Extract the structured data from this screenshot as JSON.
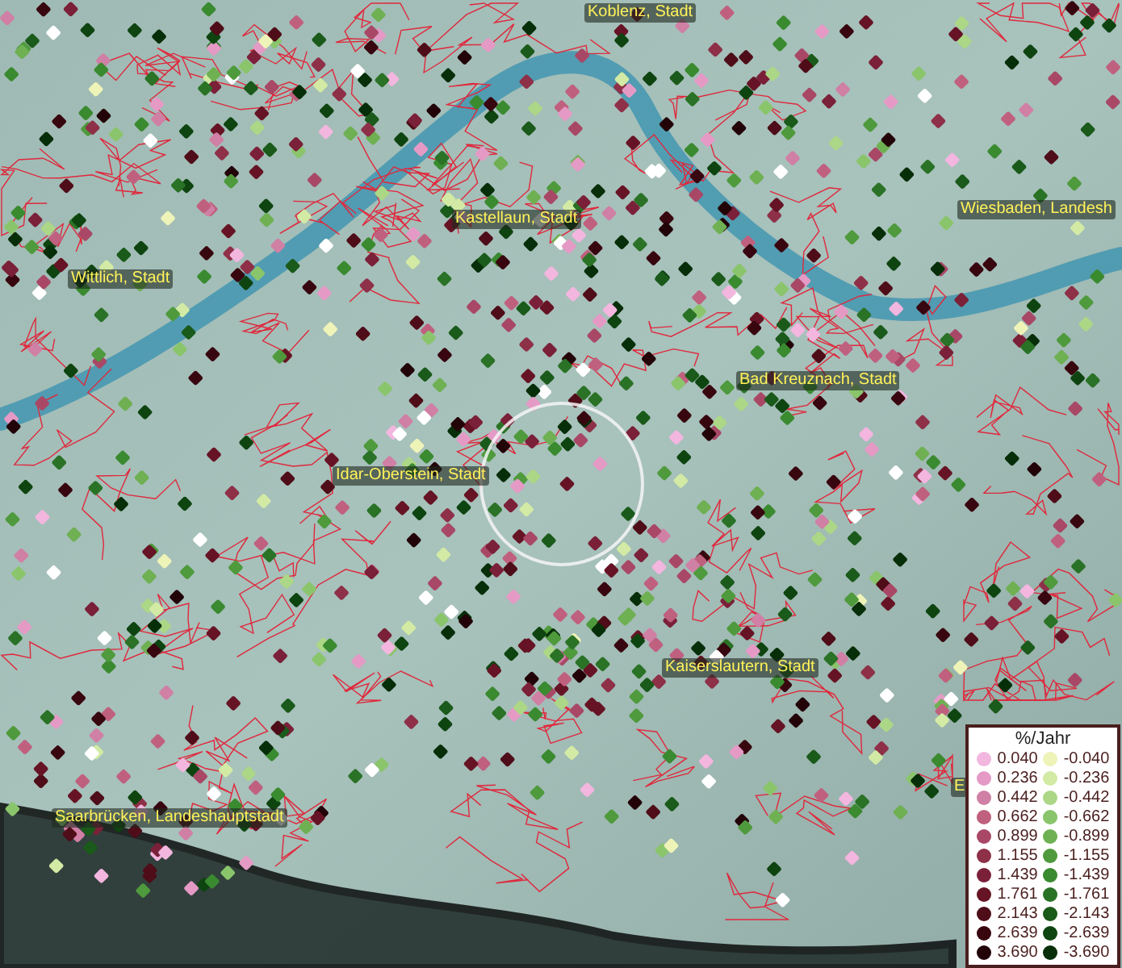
{
  "map": {
    "places": [
      {
        "name": "Koblenz, Stadt"
      },
      {
        "name": "Kastellaun, Stadt"
      },
      {
        "name": "Wiesbaden, Landesh"
      },
      {
        "name": "Wittlich, Stadt"
      },
      {
        "name": "Bad Kreuznach, Stadt"
      },
      {
        "name": "Idar-Oberstein, Stadt"
      },
      {
        "name": "Kaiserslautern, Stadt"
      },
      {
        "name": "Saarbrücken, Landeshauptstadt"
      },
      {
        "name": "E"
      }
    ]
  },
  "legend": {
    "title": "%/Jahr",
    "positive": [
      {
        "value": "0.040",
        "color": "#f2b6df"
      },
      {
        "value": "0.236",
        "color": "#e59ac6"
      },
      {
        "value": "0.442",
        "color": "#d07fa5"
      },
      {
        "value": "0.662",
        "color": "#c0607f"
      },
      {
        "value": "0.899",
        "color": "#a84866"
      },
      {
        "value": "1.155",
        "color": "#8e3048"
      },
      {
        "value": "1.439",
        "color": "#7a2038"
      },
      {
        "value": "1.761",
        "color": "#661425"
      },
      {
        "value": "2.143",
        "color": "#4e0d18"
      },
      {
        "value": "2.639",
        "color": "#38060f"
      },
      {
        "value": "3.690",
        "color": "#220308"
      }
    ],
    "negative": [
      {
        "value": "-0.040",
        "color": "#eef3b8"
      },
      {
        "value": "-0.236",
        "color": "#d2eaa4"
      },
      {
        "value": "-0.442",
        "color": "#acd786"
      },
      {
        "value": "-0.662",
        "color": "#8ac56c"
      },
      {
        "value": "-0.899",
        "color": "#6eb052"
      },
      {
        "value": "-1.155",
        "color": "#4e9a3c"
      },
      {
        "value": "-1.439",
        "color": "#3a8a30"
      },
      {
        "value": "-1.761",
        "color": "#2a7226"
      },
      {
        "value": "-2.143",
        "color": "#1a5a1a"
      },
      {
        "value": "-2.639",
        "color": "#0e4410"
      },
      {
        "value": "-3.690",
        "color": "#062e08"
      }
    ]
  }
}
